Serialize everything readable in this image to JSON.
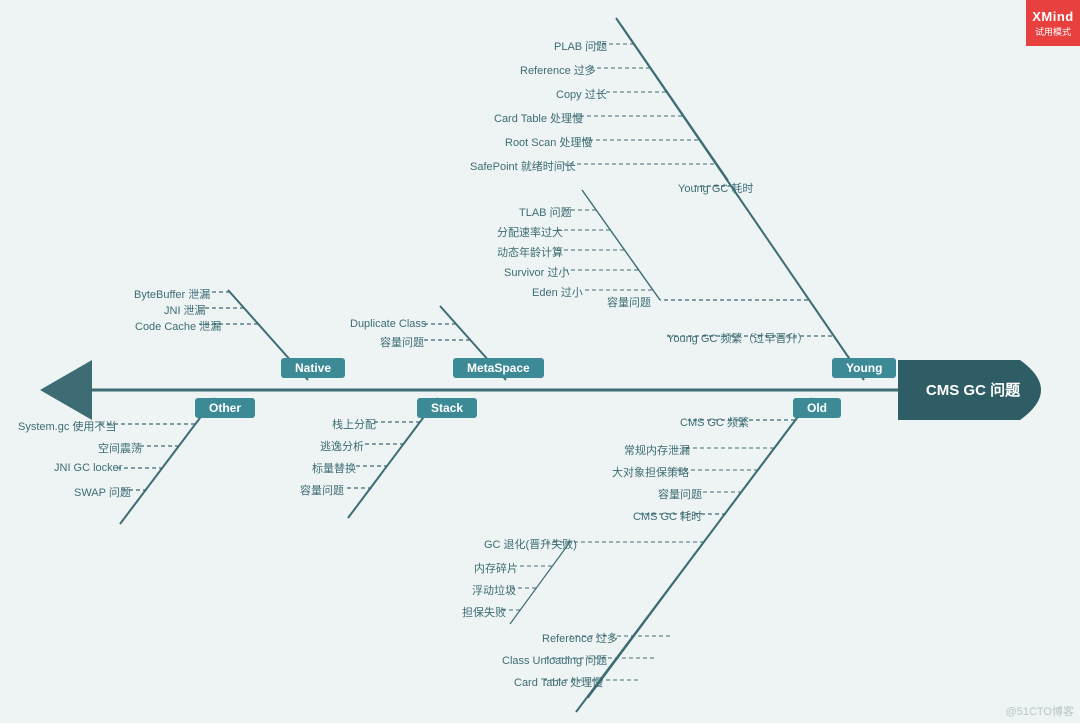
{
  "brand": {
    "name": "XMind",
    "mode": "试用模式"
  },
  "watermark": "@51CTO博客",
  "head": "CMS GC 问题",
  "categories": {
    "native": "Native",
    "metaspace": "MetaSpace",
    "young": "Young",
    "other": "Other",
    "stack": "Stack",
    "old": "Old"
  },
  "native": {
    "a": "ByteBuffer 泄漏",
    "b": "JNI 泄漏",
    "c": "Code Cache 泄漏"
  },
  "metaspace": {
    "a": "Duplicate Class",
    "b": "容量问题"
  },
  "young": {
    "branch1": "Young GC 耗时",
    "b1": {
      "a": "PLAB 问题",
      "b": "Reference 过多",
      "c": "Copy 过长",
      "d": "Card Table 处理慢",
      "e": "Root Scan 处理慢",
      "f": "SafePoint 就绪时间长"
    },
    "branch2": "Young GC 频繁（过早晋升）",
    "b2": {
      "cap": "容量问题",
      "a": "TLAB 问题",
      "b": "分配速率过大",
      "c": "动态年龄计算",
      "d": "Survivor 过小",
      "e": "Eden 过小"
    }
  },
  "other": {
    "a": "System.gc 使用不当",
    "b": "空间震荡",
    "c": "JNI GC locker",
    "d": "SWAP 问题"
  },
  "stack": {
    "a": "栈上分配",
    "b": "逃逸分析",
    "c": "标量替换",
    "d": "容量问题"
  },
  "old": {
    "b1": "CMS GC 频繁",
    "b1sub": {
      "a": "常规内存泄漏",
      "b": "大对象担保策略",
      "c": "容量问题"
    },
    "b2": "CMS GC 耗时",
    "b2a": "GC 退化(晋升失败)",
    "b2a_sub": {
      "a": "内存碎片",
      "b": "浮动垃圾",
      "c": "担保失败"
    },
    "b2b": {
      "a": "Reference 过多",
      "b": "Class Unloading 问题",
      "c": "Card Table 处理慢"
    }
  }
}
